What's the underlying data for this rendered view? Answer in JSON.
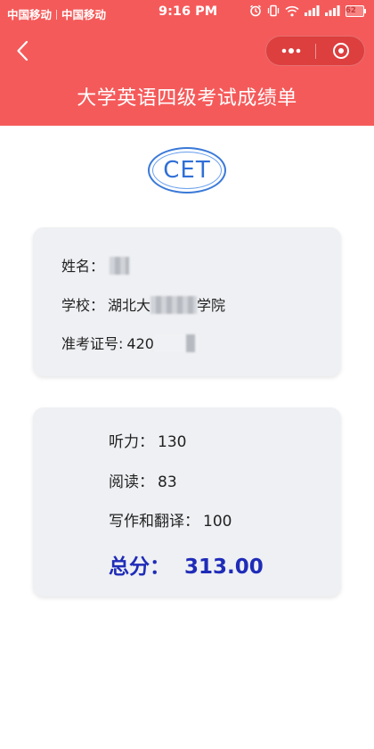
{
  "status_bar": {
    "carrier1": "中国移动",
    "carrier2": "中国移动",
    "time": "9:16 PM",
    "battery": "62"
  },
  "nav": {
    "title": "大学英语四级考试成绩单"
  },
  "logo": {
    "text": "CET"
  },
  "info": {
    "name_label": "姓名：",
    "school_label": "学校：",
    "school_value_start": "湖北大",
    "school_value_end": "学院",
    "ticket_label": "准考证号:",
    "ticket_value_start": "420"
  },
  "scores": {
    "listening_label": "听力：",
    "listening_value": "130",
    "reading_label": "阅读：",
    "reading_value": "83",
    "writing_label": "写作和翻译：",
    "writing_value": "100",
    "total_label": "总分：",
    "total_value": "313.00"
  },
  "colors": {
    "header": "#f55a5a",
    "total": "#1f2cb8",
    "logo": "#2f6fd6"
  }
}
